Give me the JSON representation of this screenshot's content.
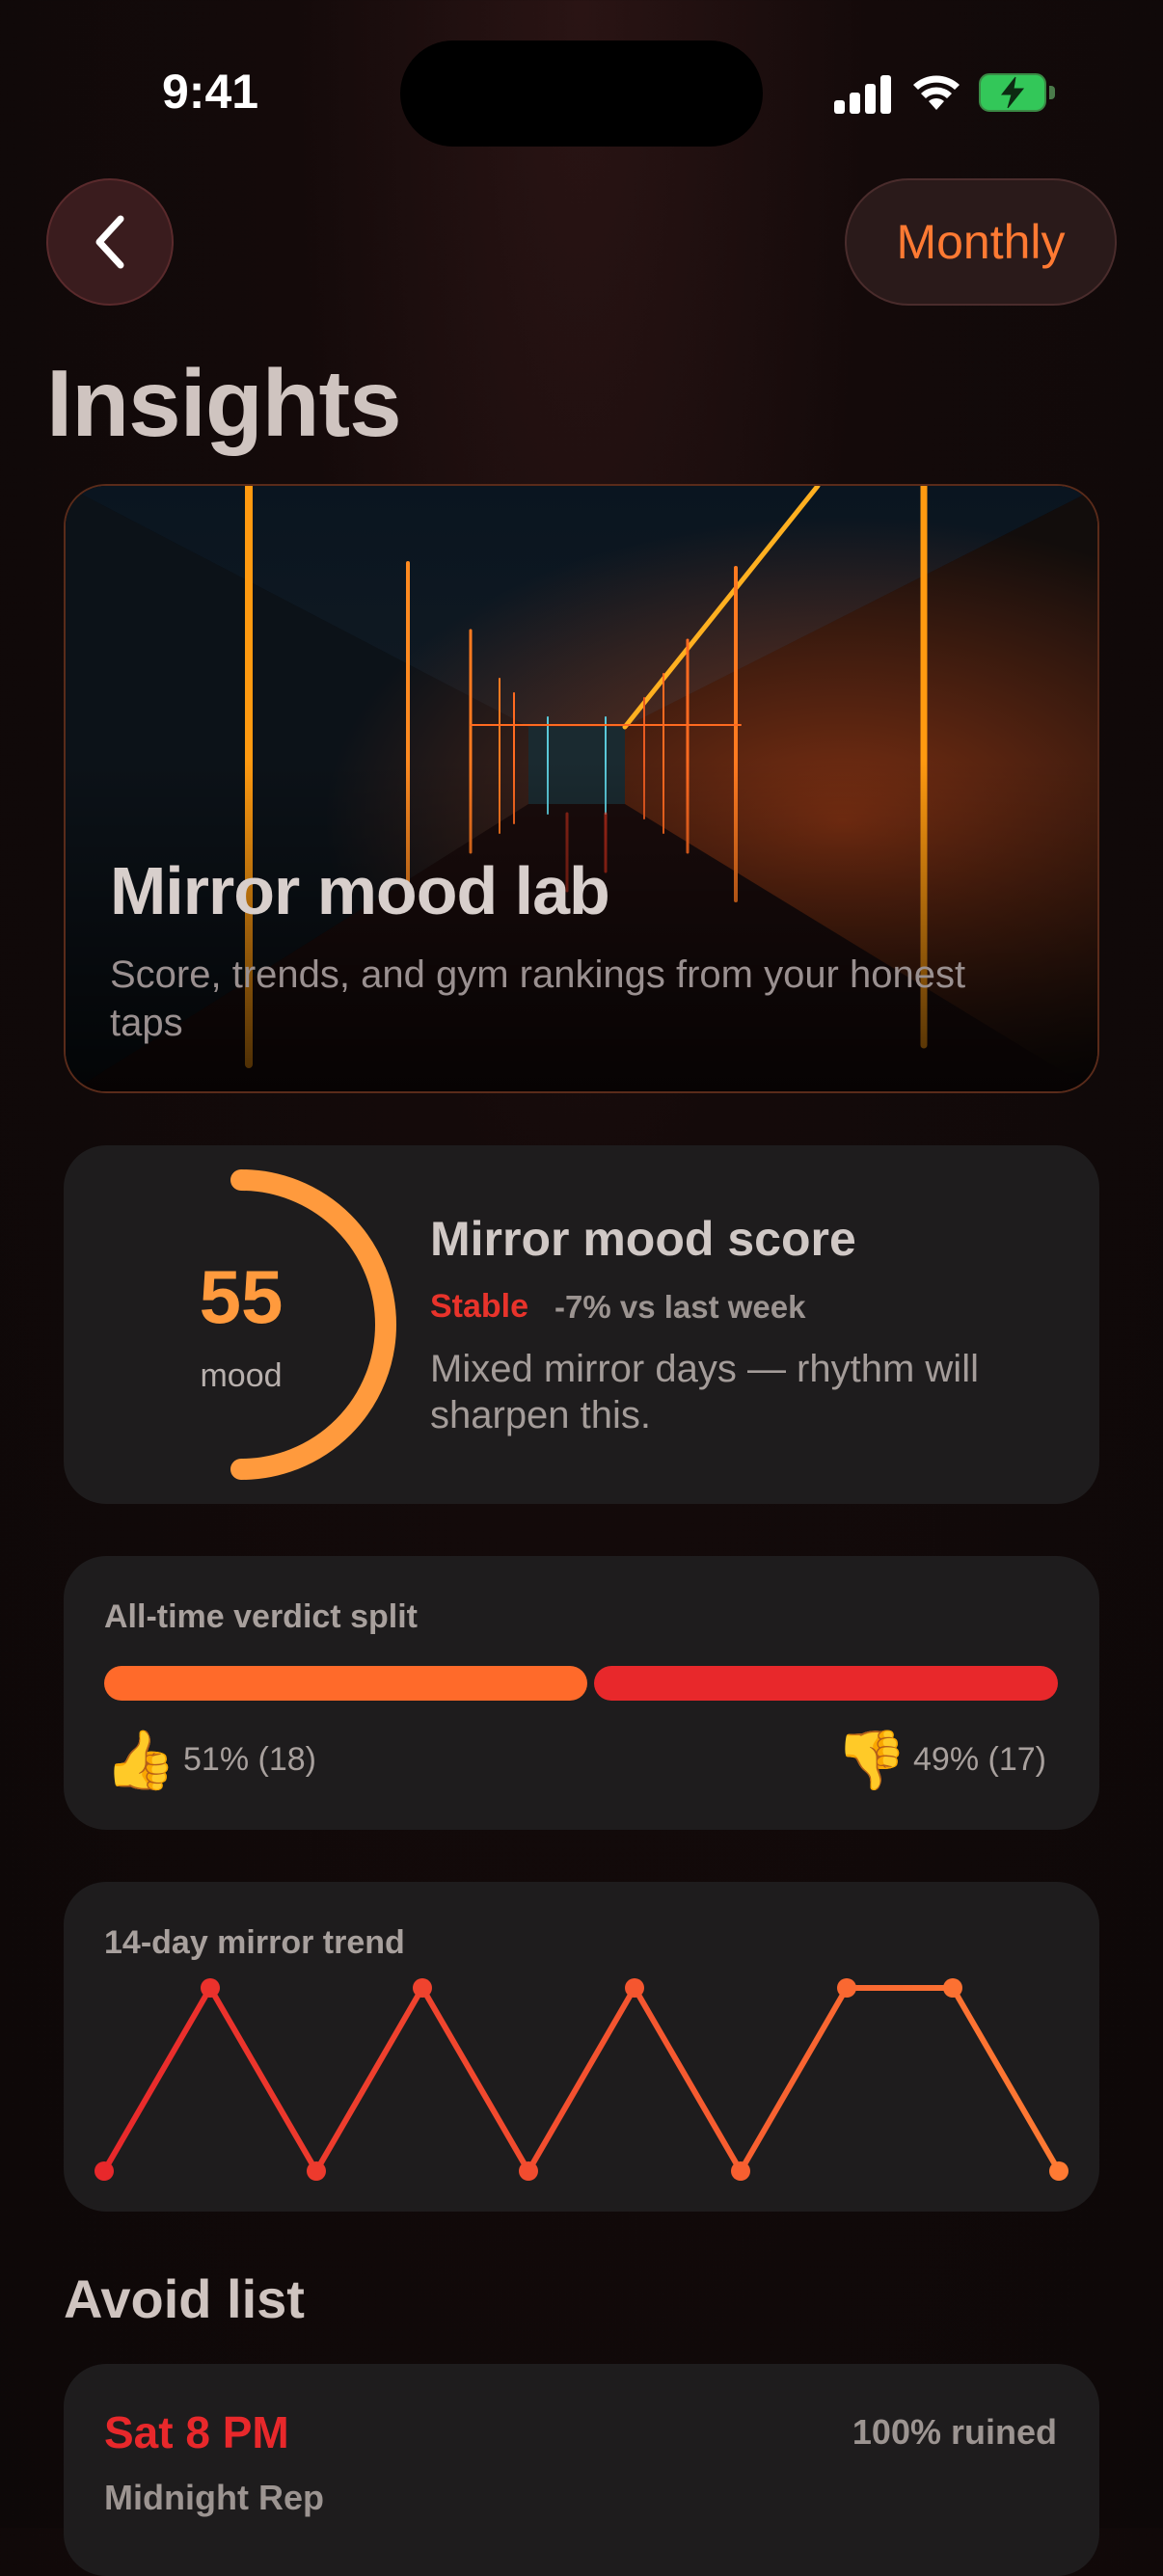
{
  "status_bar": {
    "time": "9:41"
  },
  "header": {
    "back_icon": "chevron-left-icon",
    "period_label": "Monthly",
    "title": "Insights"
  },
  "hero": {
    "title": "Mirror mood lab",
    "subtitle": "Score, trends, and gym rankings from your honest taps"
  },
  "mood_score": {
    "value": "55",
    "unit": "mood",
    "ring_fraction": 0.5,
    "title": "Mirror mood score",
    "status": "Stable",
    "delta": "-7% vs last week",
    "description": "Mixed mirror days — rhythm will sharpen this."
  },
  "verdict_split": {
    "label": "All-time verdict split",
    "up_fraction": 0.51,
    "up_icon": "thumbs-up-icon",
    "up_text": "51% (18)",
    "down_icon": "thumbs-down-icon",
    "down_text": "49% (17)"
  },
  "trend": {
    "label": "14-day mirror trend",
    "points": [
      0,
      1,
      0,
      1,
      0,
      1,
      0,
      1,
      1,
      0
    ]
  },
  "avoid_list": {
    "title": "Avoid list",
    "items": [
      {
        "time": "Sat 8 PM",
        "percent": "100% ruined",
        "name": "Midnight Rep"
      }
    ]
  },
  "colors": {
    "accent": "#ff7a33",
    "danger": "#e8282b",
    "ring": "#ff9a3d"
  }
}
